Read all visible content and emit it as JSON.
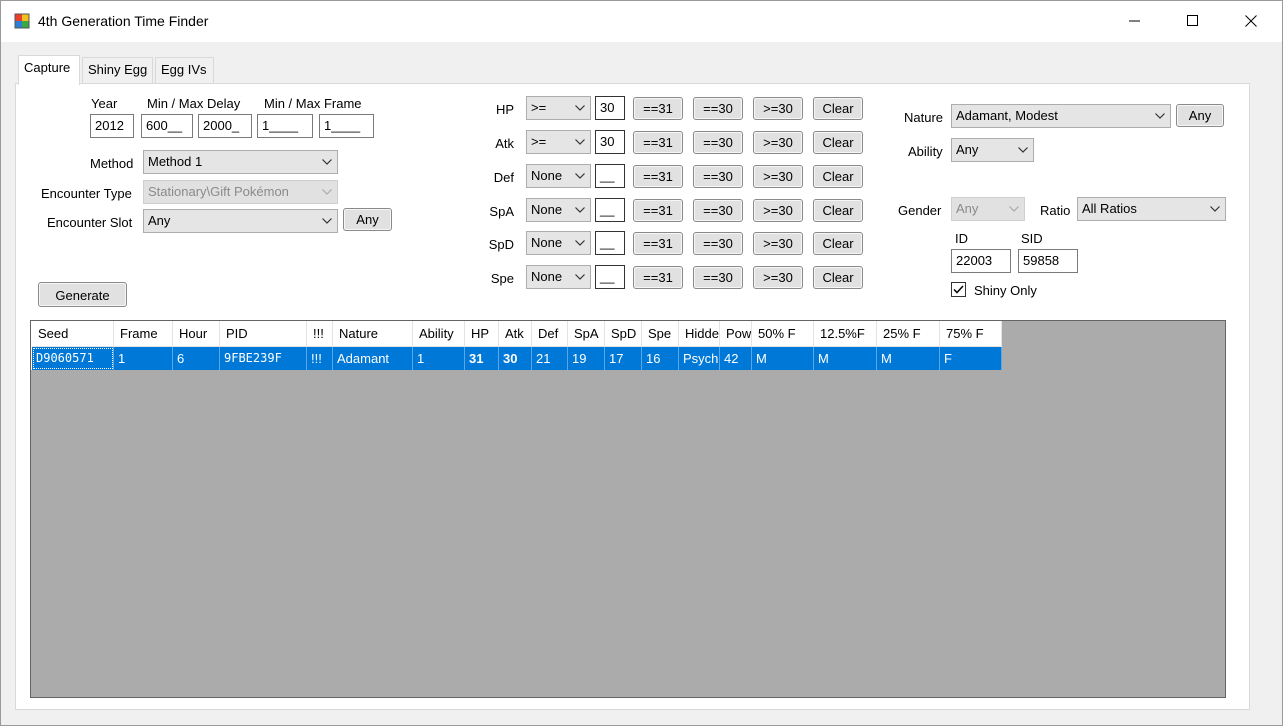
{
  "window": {
    "title": "4th Generation Time Finder",
    "icons": {
      "app": "app-icon",
      "minimize": "minimize-icon",
      "maximize": "maximize-icon",
      "close": "close-icon"
    }
  },
  "tabs": [
    {
      "label": "Capture",
      "active": true
    },
    {
      "label": "Shiny Egg",
      "active": false
    },
    {
      "label": "Egg IVs",
      "active": false
    }
  ],
  "capture": {
    "year_label": "Year",
    "delay_label": "Min / Max Delay",
    "frame_label": "Min / Max Frame",
    "year_value": "2012",
    "min_delay_value": "600__",
    "max_delay_value": "2000_",
    "min_frame_value": "1____",
    "max_frame_value": "1____",
    "method_label": "Method",
    "method_value": "Method 1",
    "encounter_type_label": "Encounter Type",
    "encounter_type_value": "Stationary\\Gift Pokémon",
    "encounter_slot_label": "Encounter Slot",
    "encounter_slot_value": "Any",
    "encounter_slot_any_button": "Any",
    "generate_button": "Generate"
  },
  "ivs": {
    "buttons": {
      "eq31": "==31",
      "eq30": "==30",
      "ge30": ">=30",
      "clear": "Clear"
    },
    "rows": [
      {
        "stat": "HP",
        "compare": ">=",
        "value": "30"
      },
      {
        "stat": "Atk",
        "compare": ">=",
        "value": "30"
      },
      {
        "stat": "Def",
        "compare": "None",
        "value": "__"
      },
      {
        "stat": "SpA",
        "compare": "None",
        "value": "__"
      },
      {
        "stat": "SpD",
        "compare": "None",
        "value": "__"
      },
      {
        "stat": "Spe",
        "compare": "None",
        "value": "__"
      }
    ]
  },
  "filters": {
    "nature_label": "Nature",
    "nature_value": "Adamant, Modest",
    "nature_any_button": "Any",
    "ability_label": "Ability",
    "ability_value": "Any",
    "gender_label": "Gender",
    "gender_value": "Any",
    "ratio_label": "Ratio",
    "ratio_value": "All Ratios",
    "id_label": "ID",
    "id_value": "22003",
    "sid_label": "SID",
    "sid_value": "59858",
    "shiny_only_label": "Shiny Only",
    "shiny_only_checked": true
  },
  "grid": {
    "columns": [
      "Seed",
      "Frame",
      "Hour",
      "PID",
      "!!!",
      "Nature",
      "Ability",
      "HP",
      "Atk",
      "Def",
      "SpA",
      "SpD",
      "Spe",
      "Hidden",
      "Power",
      "50% F",
      "12.5%F",
      "25% F",
      "75% F"
    ],
    "rows": [
      [
        "D9060571",
        "1",
        "6",
        "9FBE239F",
        "!!!",
        "Adamant",
        "1",
        "31",
        "30",
        "21",
        "19",
        "17",
        "16",
        "Psychic",
        "42",
        "M",
        "M",
        "M",
        "F"
      ]
    ],
    "selection_color": "#0078d7",
    "background_color": "#ababab"
  }
}
